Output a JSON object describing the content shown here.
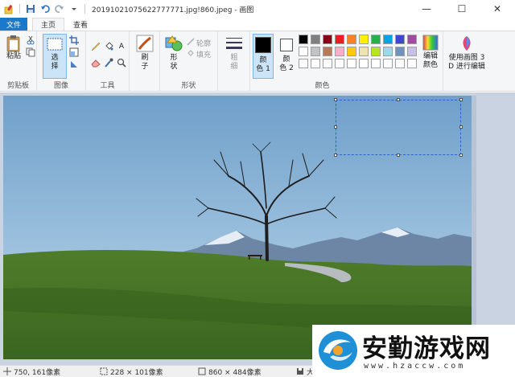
{
  "title": "20191021075622777771.jpg!860.jpeg - 画图",
  "window_buttons": {
    "minimize": "—",
    "maximize": "☐",
    "close": "✕"
  },
  "tabs": {
    "file": "文件",
    "home": "主页",
    "view": "查看"
  },
  "ribbon": {
    "clipboard": {
      "paste": "粘贴",
      "label": "剪贴板"
    },
    "image": {
      "select": "选",
      "select2": "择",
      "label": "图像"
    },
    "tools": {
      "text_icon": "A",
      "label": "工具"
    },
    "brush": {
      "label1": "刷",
      "label2": "子"
    },
    "shapes": {
      "label1": "形",
      "label2": "状",
      "outline": "轮廓",
      "fill": "填充",
      "label": "形状"
    },
    "size": {
      "label1": "粗",
      "label2": "细"
    },
    "colors": {
      "color1": "颜",
      "color1b": "色 1",
      "color2": "颜",
      "color2b": "色 2",
      "edit": "编辑",
      "editb": "颜色",
      "paint3d": "使用画图 3",
      "paint3db": "D 进行编辑",
      "label": "颜色",
      "palette_row1": [
        "#000000",
        "#7f7f7f",
        "#880015",
        "#ed1c24",
        "#ff7f27",
        "#fff200",
        "#22b14c",
        "#00a2e8",
        "#3f48cc",
        "#a349a4"
      ],
      "palette_row2": [
        "#ffffff",
        "#c3c3c3",
        "#b97a57",
        "#ffaec9",
        "#ffc90e",
        "#efe4b0",
        "#b5e61d",
        "#99d9ea",
        "#7092be",
        "#c8bfe7"
      ],
      "palette_row3": [
        "#ffffff",
        "#ffffff",
        "#ffffff",
        "#ffffff",
        "#ffffff",
        "#ffffff",
        "#ffffff",
        "#ffffff",
        "#ffffff",
        "#ffffff"
      ],
      "primary": "#000000",
      "secondary": "#ffffff"
    }
  },
  "status": {
    "cursor": "750, 161像素",
    "selection": "228 × 101像素",
    "image_size": "860 × 484像素",
    "zoom_prefix": "大小"
  },
  "watermark": {
    "brand": "安勤游戏网",
    "url": "www.hzaccw.com"
  }
}
